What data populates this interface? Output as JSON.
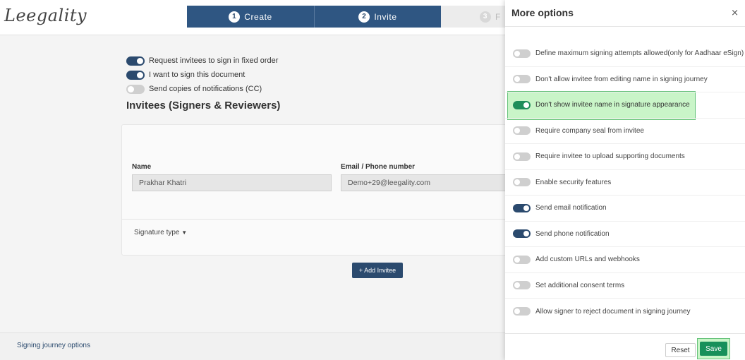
{
  "app": {
    "logo": "Leegality",
    "steps": [
      {
        "num": "1",
        "label": "Create"
      },
      {
        "num": "2",
        "label": "Invite"
      },
      {
        "num": "3",
        "label": "F"
      }
    ],
    "toggles": [
      {
        "label": "Request invitees to sign in fixed order",
        "on": true
      },
      {
        "label": "I want to sign this document",
        "on": true
      },
      {
        "label": "Send copies of notifications (CC)",
        "on": false
      }
    ],
    "section_title": "Invitees (Signers & Reviewers)",
    "invitee": {
      "name_label": "Name",
      "name_value": "Prakhar Khatri",
      "email_label": "Email / Phone number",
      "email_value": "Demo+29@leegality.com",
      "signature_type_label": "Signature type"
    },
    "add_invitee_label": "+ Add Invitee",
    "footer_link": "Signing journey options"
  },
  "drawer": {
    "title": "More options",
    "close_glyph": "×",
    "options": [
      {
        "label": "Define maximum signing attempts allowed(only for Aadhaar eSign)",
        "on": false
      },
      {
        "label": "Don't allow invitee from editing name in signing journey",
        "on": false
      },
      {
        "label": "Don't show invitee name in signature appearance",
        "on": true
      },
      {
        "label": "Require company seal from invitee",
        "on": false
      },
      {
        "label": "Require invitee to upload supporting documents",
        "on": false
      },
      {
        "label": "Enable security features",
        "on": false
      },
      {
        "label": "Send email notification",
        "on": true
      },
      {
        "label": "Send phone notification",
        "on": true
      },
      {
        "label": "Add custom URLs and webhooks",
        "on": false
      },
      {
        "label": "Set additional consent terms",
        "on": false
      },
      {
        "label": "Allow signer to reject document in signing journey",
        "on": false
      }
    ],
    "reset_label": "Reset",
    "save_label": "Save"
  },
  "colors": {
    "primary": "#2b4a6e",
    "success": "#17905a",
    "highlight": "#c9f5c8"
  }
}
